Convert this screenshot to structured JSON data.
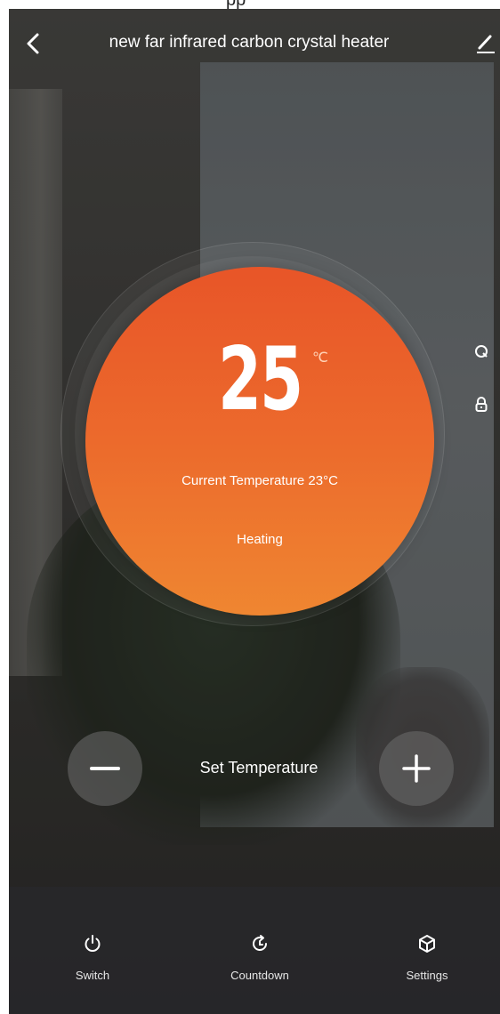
{
  "top_cap_text": "pp",
  "header": {
    "title": "new far infrared carbon crystal heater",
    "back_icon": "chevron-left-icon",
    "edit_icon": "pencil-icon"
  },
  "side_icons": [
    "timer-refresh-icon",
    "lock-icon"
  ],
  "dial": {
    "setpoint": "25",
    "unit": "℃",
    "current_temperature": "Current Temperature 23°C",
    "status": "Heating",
    "gradient_top": "#e85528",
    "gradient_bottom": "#ef8631"
  },
  "controls": {
    "decrease_icon": "minus-icon",
    "increase_icon": "plus-icon",
    "label": "Set Temperature"
  },
  "tabs": [
    {
      "label": "Switch",
      "icon": "power-icon"
    },
    {
      "label": "Countdown",
      "icon": "countdown-icon"
    },
    {
      "label": "Settings",
      "icon": "cube-icon"
    }
  ]
}
